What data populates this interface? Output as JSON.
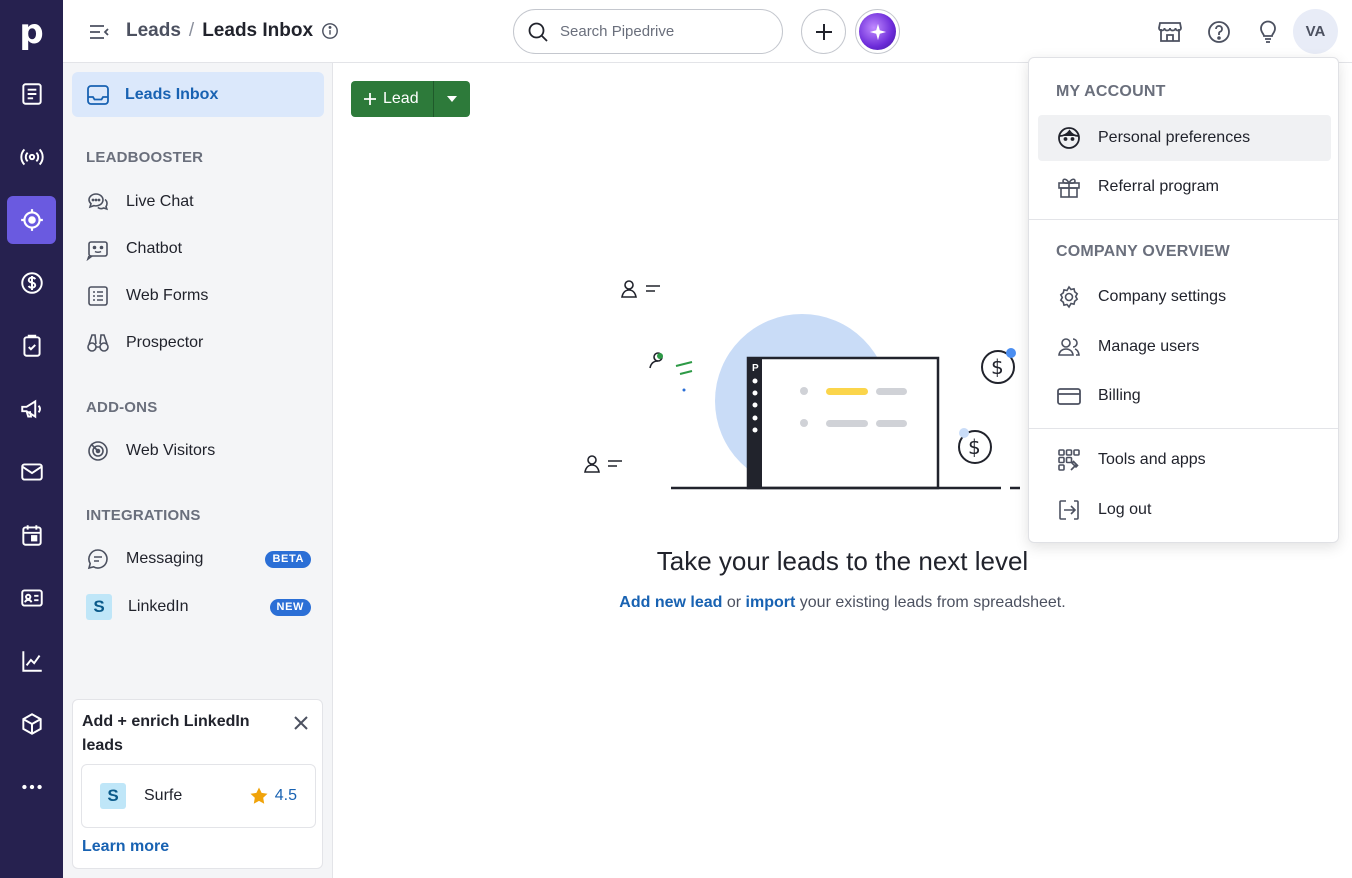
{
  "header": {
    "breadcrumb_parent": "Leads",
    "breadcrumb_separator": "/",
    "breadcrumb_current": "Leads Inbox",
    "search_placeholder": "Search Pipedrive",
    "avatar_initials": "VA"
  },
  "rail": {
    "logo": "p",
    "items": [
      "notes-icon",
      "radio-signal-icon",
      "target-icon",
      "dollar-icon",
      "clipboard-icon",
      "megaphone-icon",
      "mail-icon",
      "calendar-icon",
      "contact-card-icon",
      "chart-icon",
      "box-icon",
      "more-icon"
    ],
    "active": "target-icon"
  },
  "sidebar": {
    "active_label": "Leads Inbox",
    "sections": {
      "leadbooster": "LEADBOOSTER",
      "addons": "ADD-ONS",
      "integrations": "INTEGRATIONS"
    },
    "items": {
      "live_chat": "Live Chat",
      "chatbot": "Chatbot",
      "web_forms": "Web Forms",
      "prospector": "Prospector",
      "web_visitors": "Web Visitors",
      "messaging": "Messaging",
      "messaging_badge": "BETA",
      "linkedin": "LinkedIn",
      "linkedin_badge": "NEW"
    },
    "promo": {
      "title": "Add + enrich LinkedIn leads",
      "app_name": "Surfe",
      "app_logo": "S",
      "rating": "4.5",
      "link": "Learn more"
    }
  },
  "main": {
    "add_button": "Lead",
    "headline": "Take your leads to the next level",
    "sub_link1": "Add new lead",
    "sub_or": "or",
    "sub_link2": "import",
    "sub_rest": "your existing leads from spreadsheet."
  },
  "dropdown": {
    "section1": "MY ACCOUNT",
    "personal_preferences": "Personal preferences",
    "referral_program": "Referral program",
    "section2": "COMPANY OVERVIEW",
    "company_settings": "Company settings",
    "manage_users": "Manage users",
    "billing": "Billing",
    "tools_and_apps": "Tools and apps",
    "log_out": "Log out"
  },
  "colors": {
    "rail_bg": "#26214f",
    "rail_active": "#6a5ae0",
    "accent_blue": "#1862b2",
    "button_green": "#2d7a3a",
    "badge_blue": "#2b6fd6"
  }
}
